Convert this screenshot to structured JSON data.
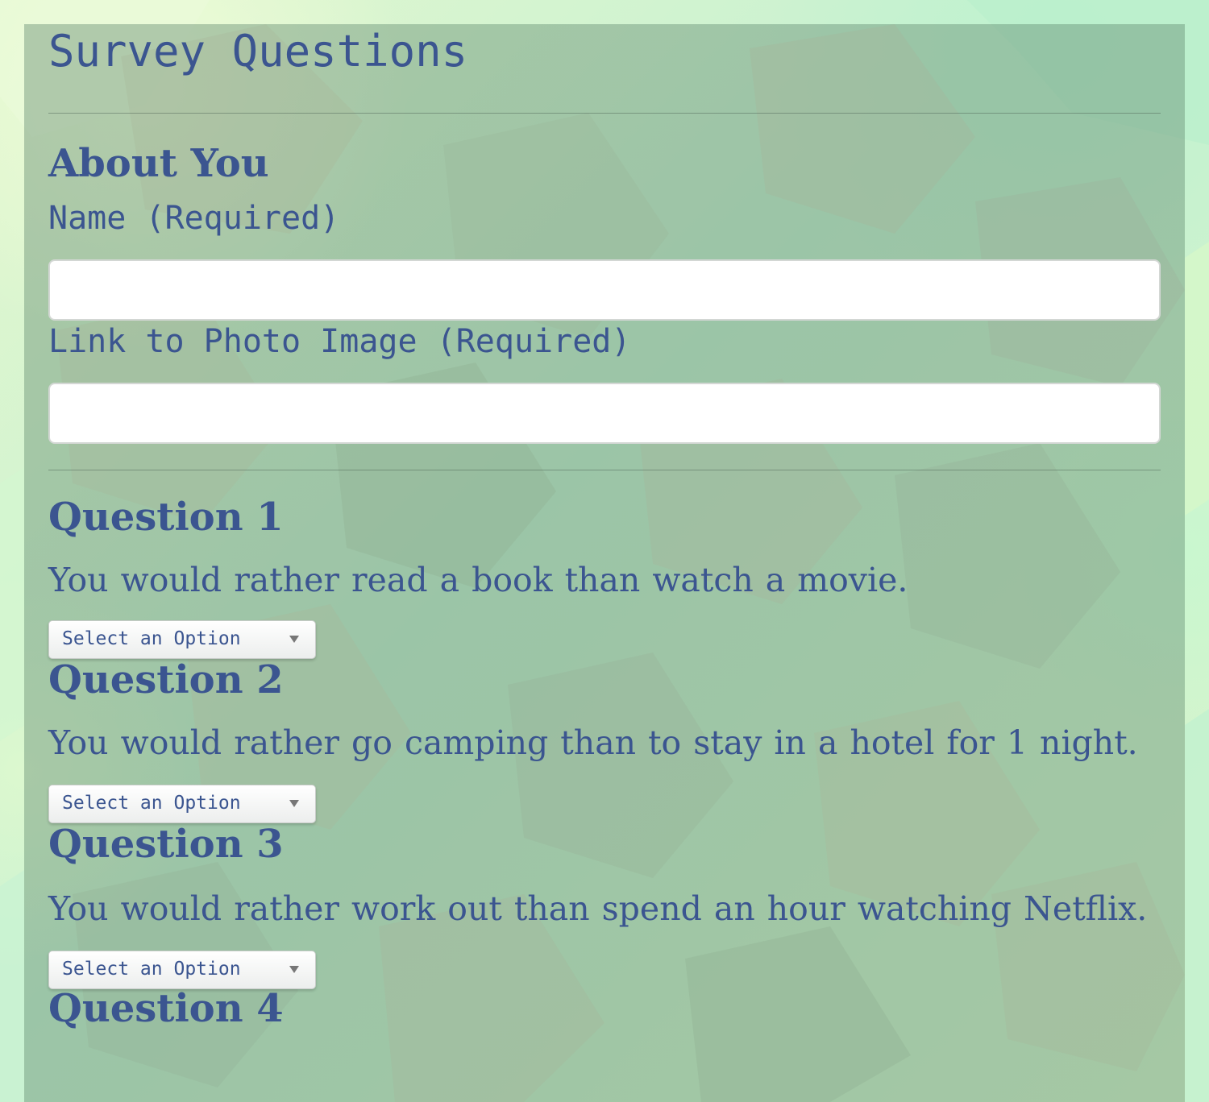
{
  "page": {
    "title": "Survey Questions"
  },
  "about": {
    "heading": "About You",
    "name_label": "Name (Required)",
    "name_value": "",
    "photo_label": "Link to Photo Image (Required)",
    "photo_value": ""
  },
  "questions": [
    {
      "heading": "Question 1",
      "text": "You would rather read a book than watch a movie.",
      "select_value": "Select an Option"
    },
    {
      "heading": "Question 2",
      "text": "You would rather go camping than to stay in a hotel for 1 night.",
      "select_value": "Select an Option"
    },
    {
      "heading": "Question 3",
      "text": "You would rather work out than spend an hour watching Netflix.",
      "select_value": "Select an Option"
    },
    {
      "heading": "Question 4"
    }
  ],
  "colors": {
    "heading_text": "#3b5590",
    "panel_overlay": "#5f876e",
    "input_background": "#ffffff"
  },
  "icons": {
    "select_arrow": "triangle-down"
  }
}
